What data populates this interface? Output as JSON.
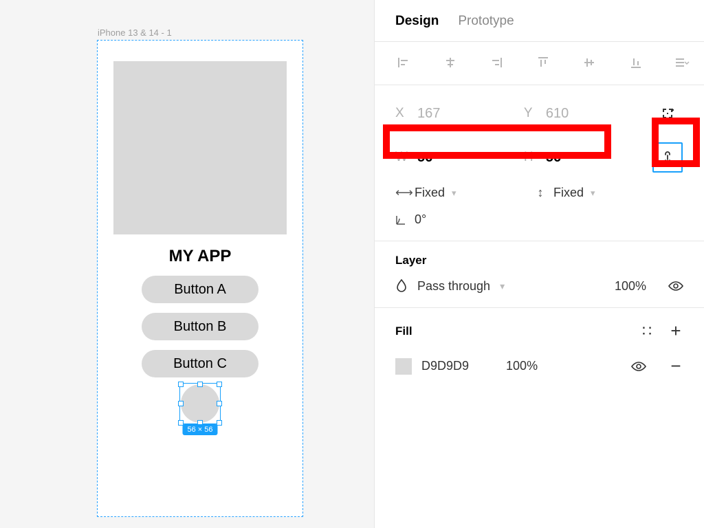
{
  "canvas": {
    "frame_label": "iPhone 13 & 14 - 1",
    "app_title": "MY APP",
    "buttons": [
      "Button A",
      "Button B",
      "Button C"
    ],
    "selection_size_label": "56 × 56"
  },
  "panel": {
    "tabs": {
      "design": "Design",
      "prototype": "Prototype"
    },
    "position": {
      "x_label": "X",
      "x_value": "167",
      "y_label": "Y",
      "y_value": "610",
      "w_label": "W",
      "w_value": "56",
      "h_label": "H",
      "h_value": "56",
      "horiz_mode": "Fixed",
      "vert_mode": "Fixed",
      "rotation_label": "0°"
    },
    "layer": {
      "title": "Layer",
      "blend_mode": "Pass through",
      "opacity": "100%"
    },
    "fill": {
      "title": "Fill",
      "color_hex": "D9D9D9",
      "opacity": "100%"
    }
  }
}
